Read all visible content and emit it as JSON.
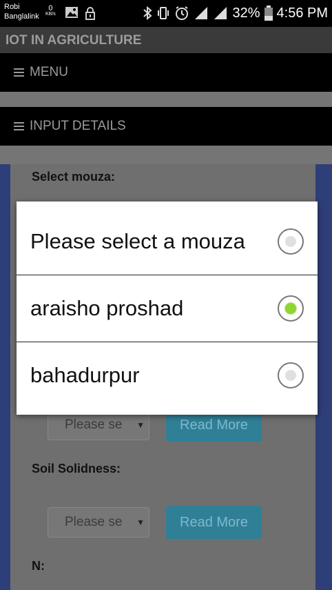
{
  "status_bar": {
    "carrier_line1": "Robi",
    "carrier_line2": "Banglalink",
    "speed_value": "0",
    "speed_unit": "KB/s",
    "battery": "32%",
    "time": "4:56 PM"
  },
  "app": {
    "title": "IOT IN AGRICULTURE"
  },
  "menus": {
    "menu_label": "MENU",
    "input_details_label": "INPUT DETAILS"
  },
  "form": {
    "select_mouza_label": "Select mouza:",
    "select_placeholder": "Please se",
    "read_more": "Read More",
    "soil_solidness_label": "Soil Solidness:",
    "n_label": "N:"
  },
  "dialog": {
    "options": [
      {
        "label": "Please select a mouza",
        "selected": false
      },
      {
        "label": "araisho proshad",
        "selected": true
      },
      {
        "label": "bahadurpur",
        "selected": false
      }
    ]
  },
  "colors": {
    "radio_selected": "#8fd62f",
    "read_more_button": "#2f7f97",
    "side_border": "#2e3e78"
  }
}
